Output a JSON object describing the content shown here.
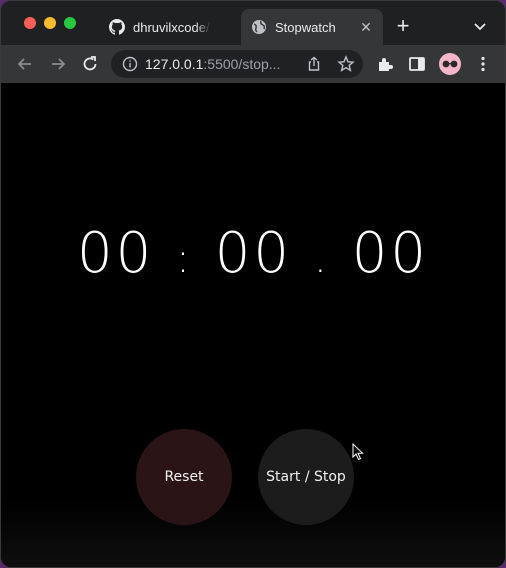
{
  "browser": {
    "tabs": [
      {
        "title": "dhruvilxcode/",
        "favicon": "github-icon",
        "active": false
      },
      {
        "title": "Stopwatch",
        "favicon": "globe-icon",
        "active": true
      }
    ],
    "url_host": "127.0.0.1",
    "url_rest": ":5500/stop..."
  },
  "stopwatch": {
    "minutes": "00",
    "seconds": "00",
    "centiseconds": "00",
    "sep_colon": ":",
    "sep_dot": ".",
    "reset_label": "Reset",
    "startstop_label": "Start / Stop"
  },
  "colors": {
    "background": "#000000",
    "reset_button": "#2a1416",
    "startstop_button": "#1c1c1c"
  }
}
